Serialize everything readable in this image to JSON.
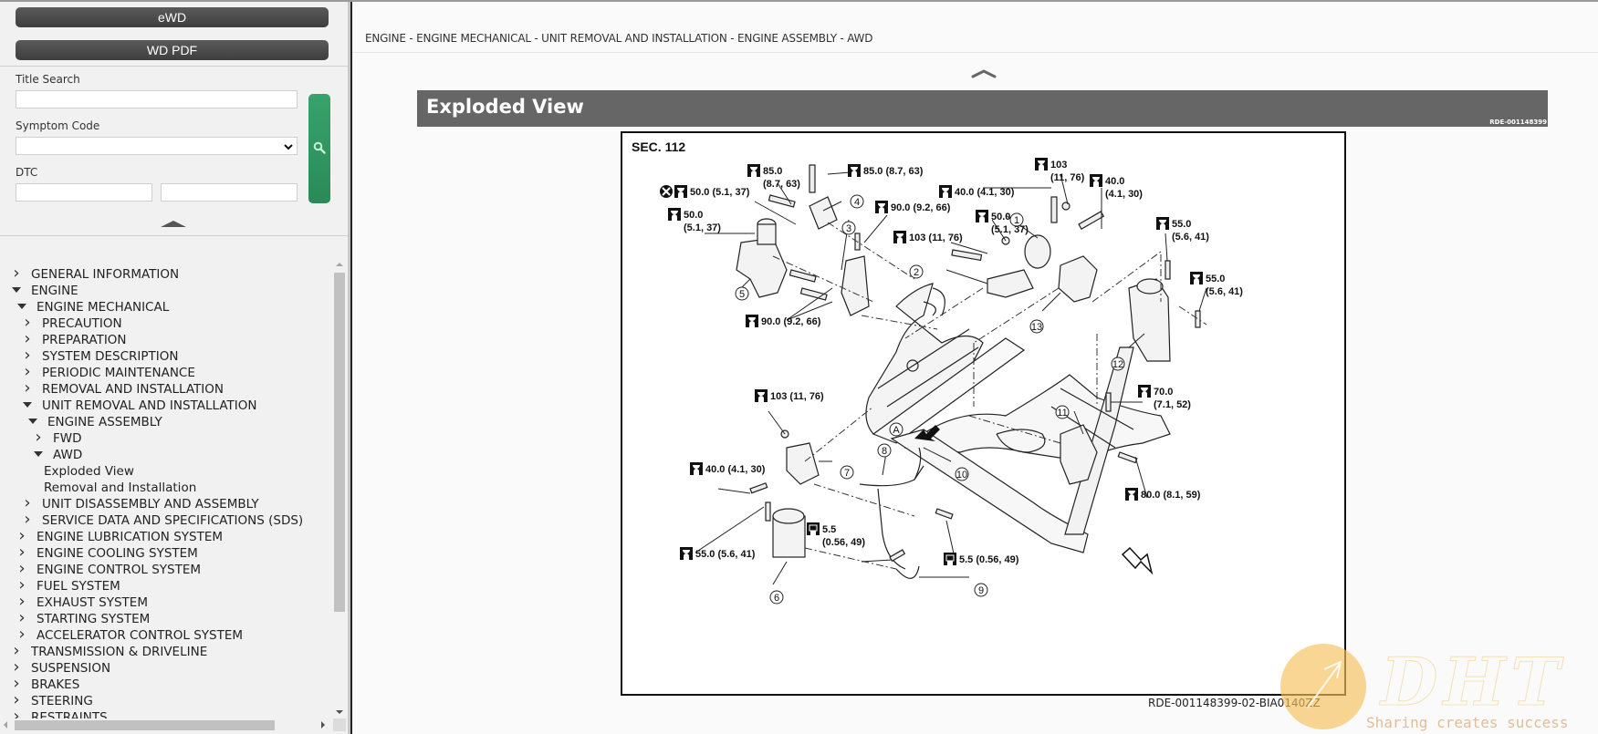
{
  "sidebar": {
    "ewd_button": "eWD",
    "wdpdf_button": "WD PDF",
    "title_search": {
      "label": "Title Search",
      "value": "",
      "placeholder": ""
    },
    "symptom_code": {
      "label": "Symptom Code",
      "selected": ""
    },
    "dtc": {
      "label": "DTC",
      "value1": "",
      "value2": ""
    },
    "search_button_icon": "search-icon",
    "collapse_icon": "chevron-up-icon",
    "tree": [
      {
        "label": "GENERAL INFORMATION",
        "level": 0,
        "state": "closed"
      },
      {
        "label": "ENGINE",
        "level": 0,
        "state": "open"
      },
      {
        "label": "ENGINE MECHANICAL",
        "level": 1,
        "state": "open"
      },
      {
        "label": "PRECAUTION",
        "level": 2,
        "state": "closed"
      },
      {
        "label": "PREPARATION",
        "level": 2,
        "state": "closed"
      },
      {
        "label": "SYSTEM DESCRIPTION",
        "level": 2,
        "state": "closed"
      },
      {
        "label": "PERIODIC MAINTENANCE",
        "level": 2,
        "state": "closed"
      },
      {
        "label": "REMOVAL AND INSTALLATION",
        "level": 2,
        "state": "closed"
      },
      {
        "label": "UNIT REMOVAL AND INSTALLATION",
        "level": 2,
        "state": "open"
      },
      {
        "label": "ENGINE ASSEMBLY",
        "level": 3,
        "state": "open"
      },
      {
        "label": "FWD",
        "level": 4,
        "state": "closed"
      },
      {
        "label": "AWD",
        "level": 4,
        "state": "open"
      },
      {
        "label": "Exploded View",
        "level": 5,
        "state": "leaf"
      },
      {
        "label": "Removal and Installation",
        "level": 5,
        "state": "leaf"
      },
      {
        "label": "UNIT DISASSEMBLY AND ASSEMBLY",
        "level": 2,
        "state": "closed"
      },
      {
        "label": "SERVICE DATA AND SPECIFICATIONS (SDS)",
        "level": 2,
        "state": "closed"
      },
      {
        "label": "ENGINE LUBRICATION SYSTEM",
        "level": 1,
        "state": "closed"
      },
      {
        "label": "ENGINE COOLING SYSTEM",
        "level": 1,
        "state": "closed"
      },
      {
        "label": "ENGINE CONTROL SYSTEM",
        "level": 1,
        "state": "closed"
      },
      {
        "label": "FUEL SYSTEM",
        "level": 1,
        "state": "closed"
      },
      {
        "label": "EXHAUST SYSTEM",
        "level": 1,
        "state": "closed"
      },
      {
        "label": "STARTING SYSTEM",
        "level": 1,
        "state": "closed"
      },
      {
        "label": "ACCELERATOR CONTROL SYSTEM",
        "level": 1,
        "state": "closed"
      },
      {
        "label": "TRANSMISSION & DRIVELINE",
        "level": 0,
        "state": "closed"
      },
      {
        "label": "SUSPENSION",
        "level": 0,
        "state": "closed"
      },
      {
        "label": "BRAKES",
        "level": 0,
        "state": "closed"
      },
      {
        "label": "STEERING",
        "level": 0,
        "state": "closed"
      },
      {
        "label": "RESTRAINTS",
        "level": 0,
        "state": "closed"
      }
    ]
  },
  "main": {
    "breadcrumb": "ENGINE - ENGINE MECHANICAL - UNIT REMOVAL AND INSTALLATION - ENGINE ASSEMBLY - AWD",
    "collapse_icon": "chevron-up-icon",
    "section_title": "Exploded View",
    "section_ref": "RDE-001148399",
    "figure": {
      "section_label": "SEC. 112",
      "caption": "RDE-001148399-02-BIA0140ZZ",
      "torque_labels": [
        {
          "id": "t1",
          "line1": "85.0",
          "line2": "(8.7, 63)"
        },
        {
          "id": "t2",
          "line1": "85.0 (8.7, 63)",
          "line2": ""
        },
        {
          "id": "t3",
          "line1": "50.0 (5.1, 37)",
          "line2": "",
          "non_reusable": true
        },
        {
          "id": "t4",
          "line1": "50.0",
          "line2": "(5.1, 37)"
        },
        {
          "id": "t5",
          "line1": "90.0 (9.2, 66)",
          "line2": ""
        },
        {
          "id": "t6",
          "line1": "103 (11, 76)",
          "line2": ""
        },
        {
          "id": "t7",
          "line1": "90.0 (9.2, 66)",
          "line2": ""
        },
        {
          "id": "t8",
          "line1": "40.0 (4.1, 30)",
          "line2": ""
        },
        {
          "id": "t9",
          "line1": "50.0",
          "line2": "(5.1, 37)"
        },
        {
          "id": "t10",
          "line1": "103",
          "line2": "(11, 76)"
        },
        {
          "id": "t11",
          "line1": "40.0",
          "line2": "(4.1, 30)"
        },
        {
          "id": "t12",
          "line1": "55.0",
          "line2": "(5.6, 41)"
        },
        {
          "id": "t13",
          "line1": "55.0",
          "line2": "(5.6, 41)"
        },
        {
          "id": "t14",
          "line1": "103 (11, 76)",
          "line2": ""
        },
        {
          "id": "t15",
          "line1": "70.0",
          "line2": "(7.1, 52)"
        },
        {
          "id": "t16",
          "line1": "40.0 (4.1, 30)",
          "line2": ""
        },
        {
          "id": "t17",
          "line1": "80.0 (8.1, 59)",
          "line2": ""
        },
        {
          "id": "t18",
          "line1": "5.5",
          "line2": "(0.56, 49)",
          "dark": true
        },
        {
          "id": "t19",
          "line1": "55.0 (5.6, 41)",
          "line2": ""
        },
        {
          "id": "t20",
          "line1": "5.5 (0.56, 49)",
          "line2": "",
          "dark": true
        }
      ],
      "callouts": [
        "1",
        "2",
        "3",
        "4",
        "5",
        "6",
        "7",
        "8",
        "9",
        "10",
        "11",
        "12",
        "13",
        "A"
      ]
    }
  },
  "watermark": {
    "logo": "DHT",
    "tagline": "Sharing creates success"
  }
}
